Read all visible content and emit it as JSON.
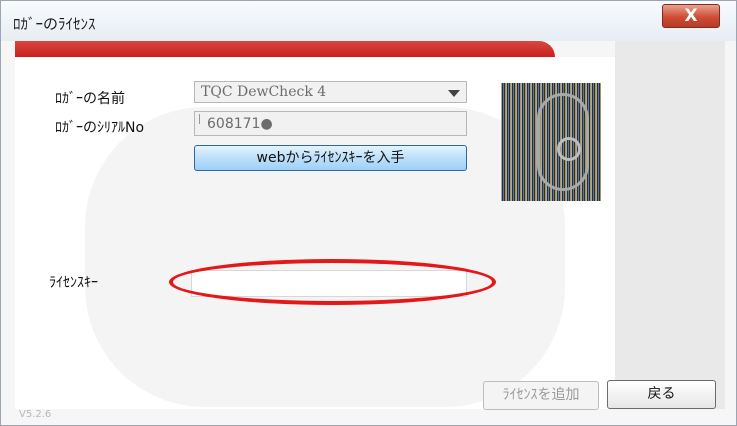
{
  "window": {
    "title": "ﾛｶﾞｰのﾗｲｾﾝｽ",
    "close_label": "X"
  },
  "form": {
    "logger_name_label": "ﾛｶﾞｰの名前",
    "logger_name_value": "TQC DewCheck 4",
    "serial_label": "ﾛｶﾞｰのｼﾘｱﾙNo",
    "serial_value": "608171●",
    "get_license_button": "webからﾗｲｾﾝｽｷｰを入手",
    "license_key_label": "ﾗｲｾﾝｽｷｰ",
    "license_key_value": ""
  },
  "buttons": {
    "add_license": "ﾗｲｾﾝｽを追加",
    "back": "戻る"
  },
  "footer": {
    "version": "V5.2.6"
  },
  "colors": {
    "accent_red": "#c8201d",
    "annotation_red": "#e41818",
    "button_blue": "#9fd0f7"
  },
  "icons": {
    "close": "close-icon",
    "dropdown": "chevron-down-icon",
    "device": "device-image"
  }
}
